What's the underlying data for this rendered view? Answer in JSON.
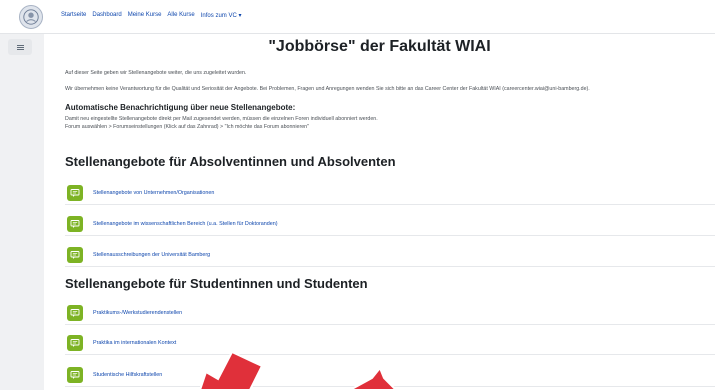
{
  "nav": {
    "items": [
      "Startseite",
      "Dashboard",
      "Meine Kurse",
      "Alle Kurse",
      "Infos zum VC ▾"
    ]
  },
  "page": {
    "title": "\"Jobbörse\" der Fakultät WIAI",
    "intro1": "Auf dieser Seite geben wir Stellenangebote weiter, die uns zugeleitet wurden.",
    "intro2": "Wir übernehmen keine Verantwortung für die Qualität und Seriosität der Angebote. Bei Problemen, Fragen und Anregungen wenden Sie sich bitte an das Career Center der Fakultät WIAI (careercenter.wiai@uni-bamberg.de).",
    "subhead": "Automatische Benachrichtigung über neue Stellenangebote:",
    "notice1": "Damit neu eingestellte Stellenangebote direkt per Mail zugesendet werden, müssen die einzelnen Foren individuell abonniert werden.",
    "notice2": "Forum auswählen > Forumseinstellungen (Klick auf das Zahnrad) > \"Ich möchte das Forum abonnieren\""
  },
  "sections": [
    {
      "title": "Stellenangebote für Absolventinnen und Absolventen",
      "items": [
        "Stellenangebote von Unternehmen/Organisationen",
        "Stellenangebote im wissenschaftlichen Bereich (u.a. Stellen für Doktoranden)",
        "Stellenausschreibungen der Universität Bamberg"
      ]
    },
    {
      "title": "Stellenangebote für Studentinnen und Studenten",
      "items": [
        "Praktikums-/Werkstudierendenstellen",
        "Praktika im internationalen Kontext",
        "Studentische Hilfskraftstellen"
      ]
    }
  ],
  "colors": {
    "activity_icon": "#7db324",
    "link": "#0f47ad",
    "annotation": "#e0303a"
  },
  "icons": {
    "logo": "university-seal-icon",
    "drawer": "hamburger-icon",
    "activity": "forum-icon"
  }
}
